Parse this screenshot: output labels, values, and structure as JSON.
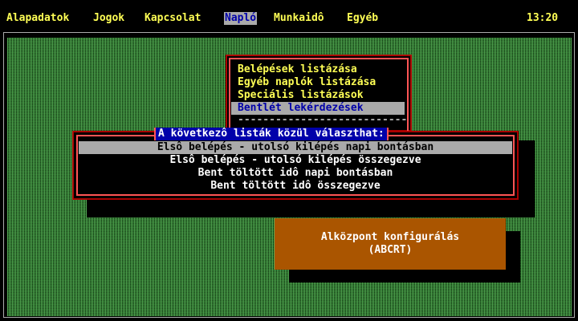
{
  "menubar": {
    "items": [
      {
        "label": "Alapadatok"
      },
      {
        "label": "Jogok"
      },
      {
        "label": "Kapcsolat"
      },
      {
        "label": "Napló",
        "active": true
      },
      {
        "label": "Munkaidô"
      },
      {
        "label": "Egyéb"
      }
    ],
    "clock": "13:20"
  },
  "submenu": {
    "items": [
      "Belépések listázása",
      "Egyéb naplók listázása",
      "Speciális listázások",
      "Bentlét lekérdezések"
    ],
    "selected_index": 3,
    "separator": "---------------------------"
  },
  "dialog": {
    "title": "A következô listák közül választhat:",
    "options": [
      "Elsô belépés - utolsó kilépés napi bontásban",
      "Elsô belépés - utolsó kilépés összegezve",
      "Bent töltött idô napi bontásban",
      "Bent töltött idô összegezve"
    ],
    "selected_index": 0
  },
  "info": {
    "line1": "Alközpont konfigurálás",
    "line2": "(ABCRT)"
  },
  "colors": {
    "yellow": "#ffff55",
    "highlight_bg": "#aaaaaa",
    "title_bg": "#0000aa",
    "border_dark_red": "#aa0000",
    "border_light_red": "#ff5555",
    "info_bg": "#aa5500",
    "desktop_green": "#55aa55"
  }
}
